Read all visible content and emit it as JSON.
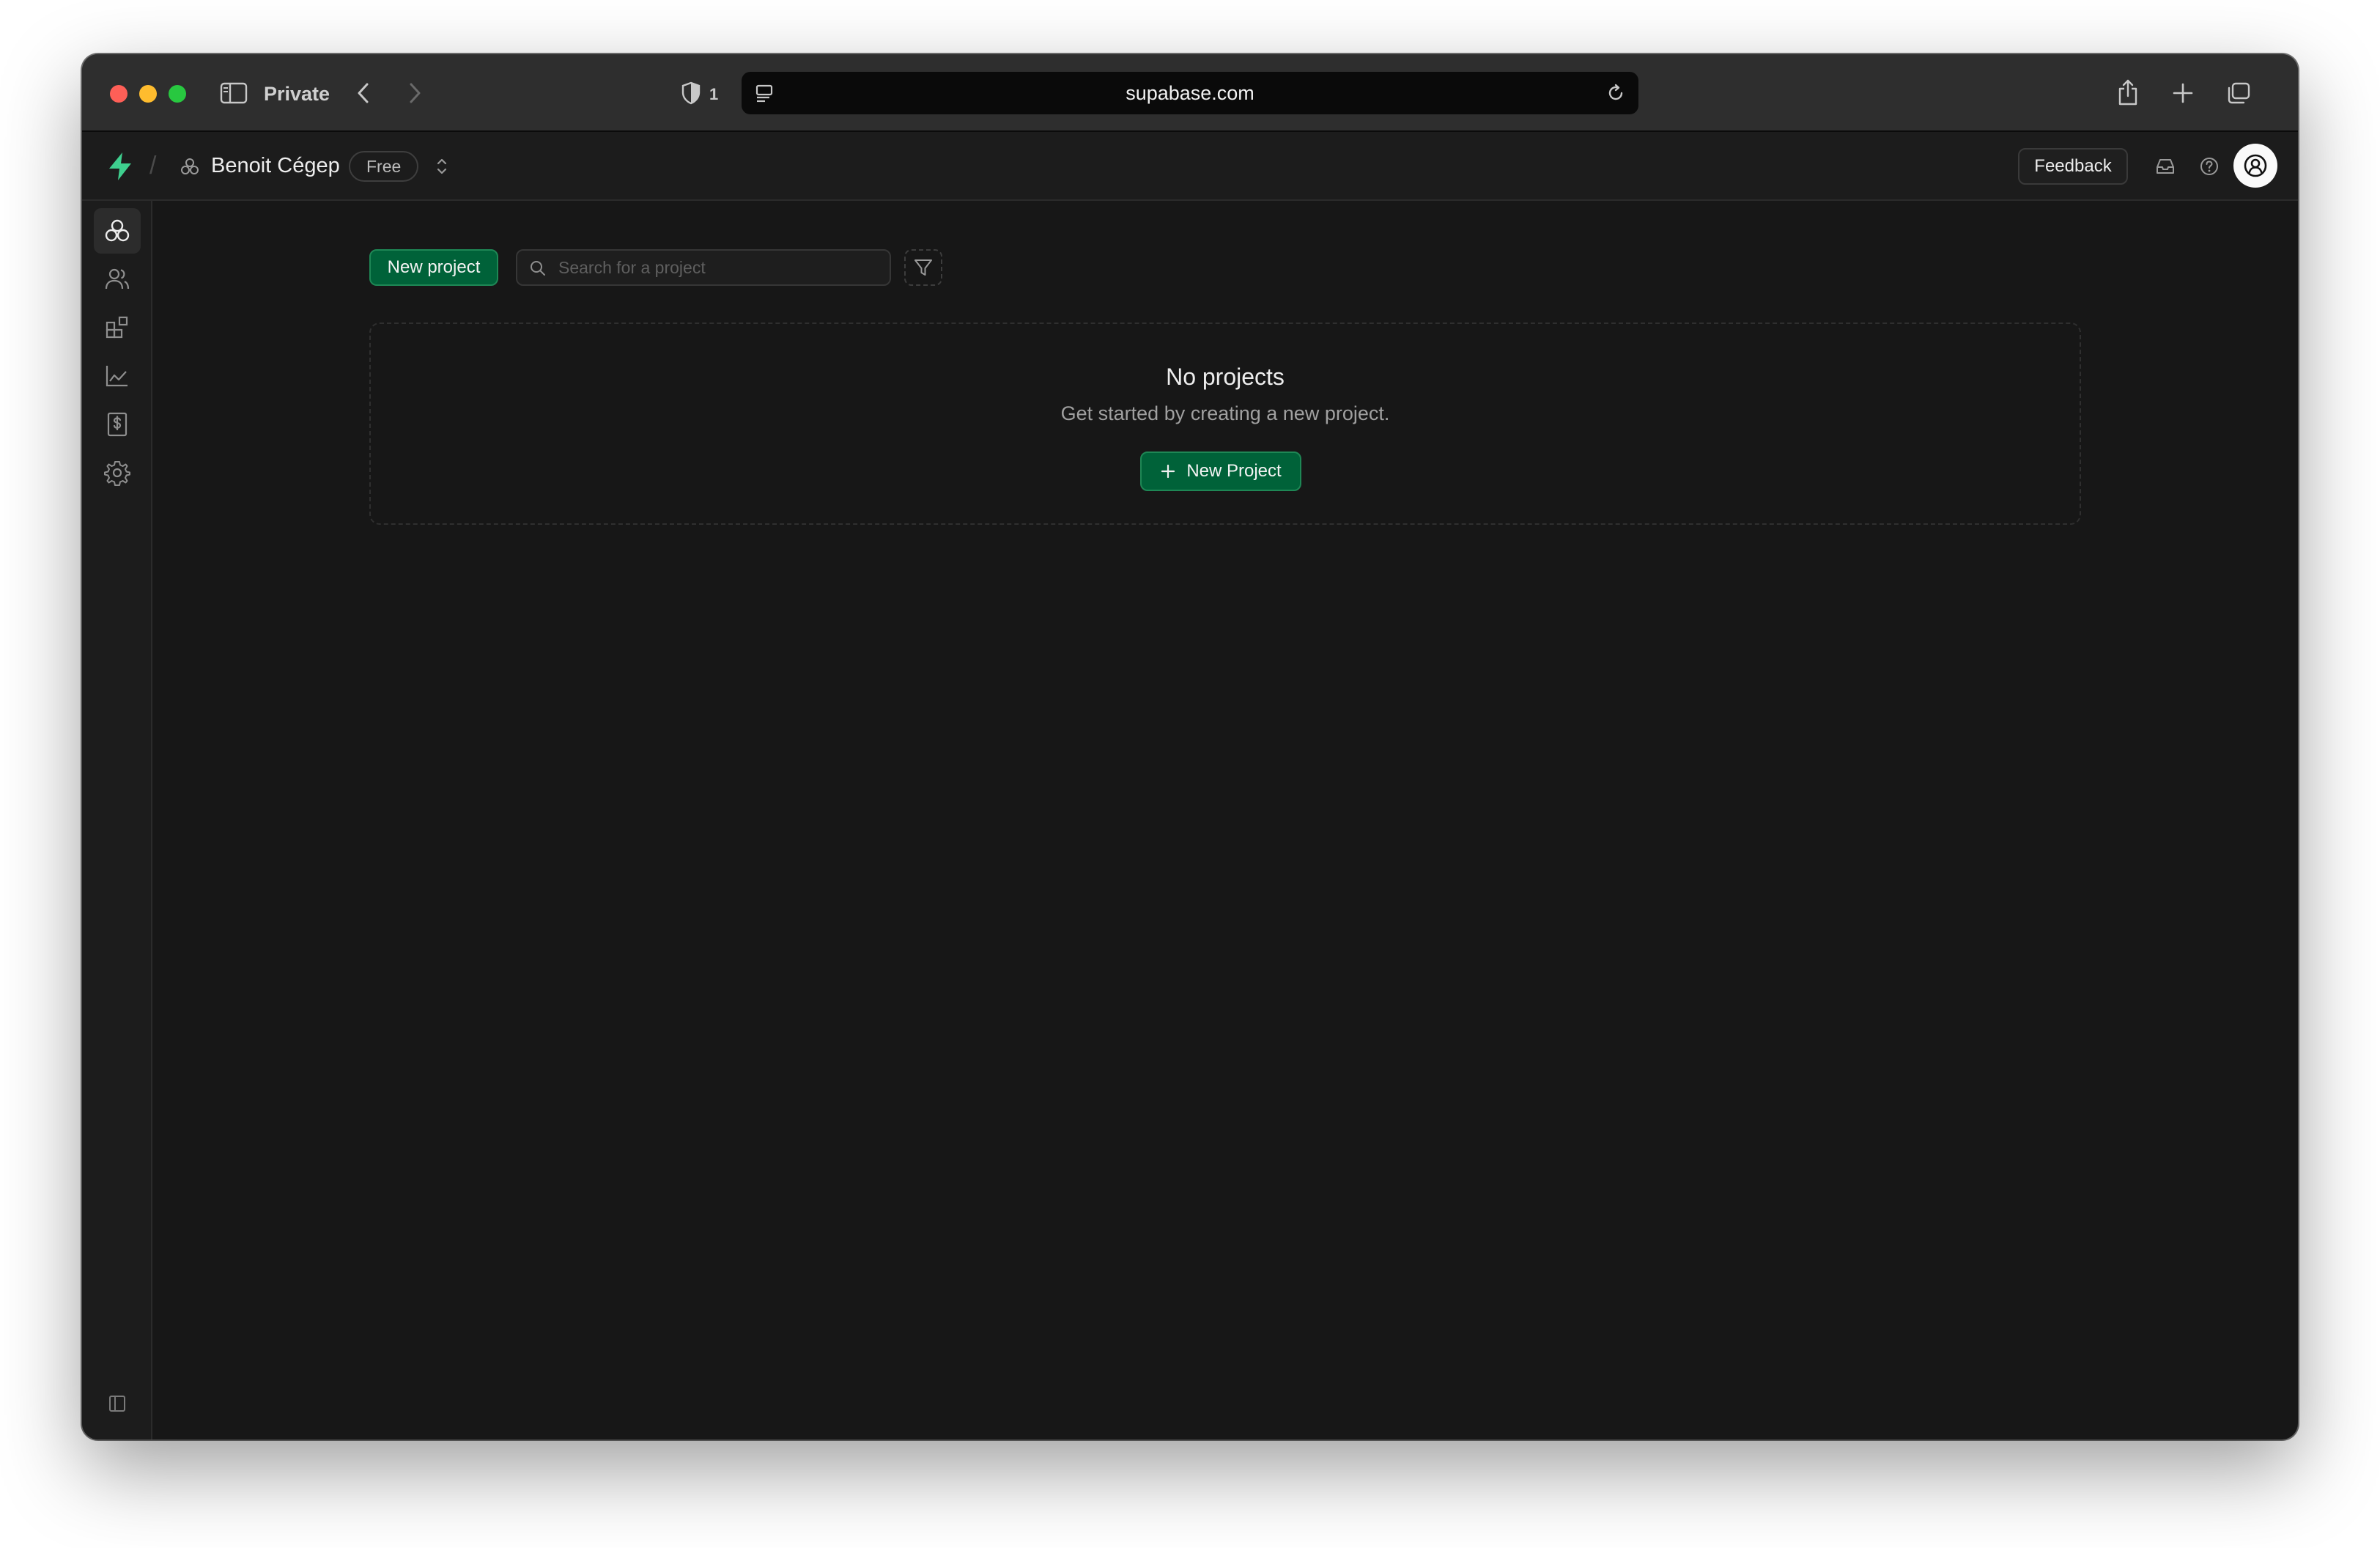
{
  "browser": {
    "window_mode": "Private",
    "blocked_trackers_count": "1",
    "url": "supabase.com"
  },
  "topbar": {
    "org_name": "Benoit Cégep",
    "plan": "Free",
    "feedback_label": "Feedback"
  },
  "sidebar": {
    "items": [
      {
        "name": "projects",
        "icon": "projects-icon",
        "active": true
      },
      {
        "name": "team",
        "icon": "users-icon"
      },
      {
        "name": "integrations",
        "icon": "integrations-icon"
      },
      {
        "name": "usage",
        "icon": "chart-icon"
      },
      {
        "name": "billing",
        "icon": "billing-icon"
      },
      {
        "name": "settings",
        "icon": "gear-icon"
      }
    ]
  },
  "main": {
    "new_project_label": "New project",
    "search_placeholder": "Search for a project",
    "empty_title": "No projects",
    "empty_subtitle": "Get started by creating a new project.",
    "empty_button_label": "New Project"
  },
  "colors": {
    "accent": "#3ecf8e",
    "button_bg": "#006239",
    "background": "#171717"
  }
}
